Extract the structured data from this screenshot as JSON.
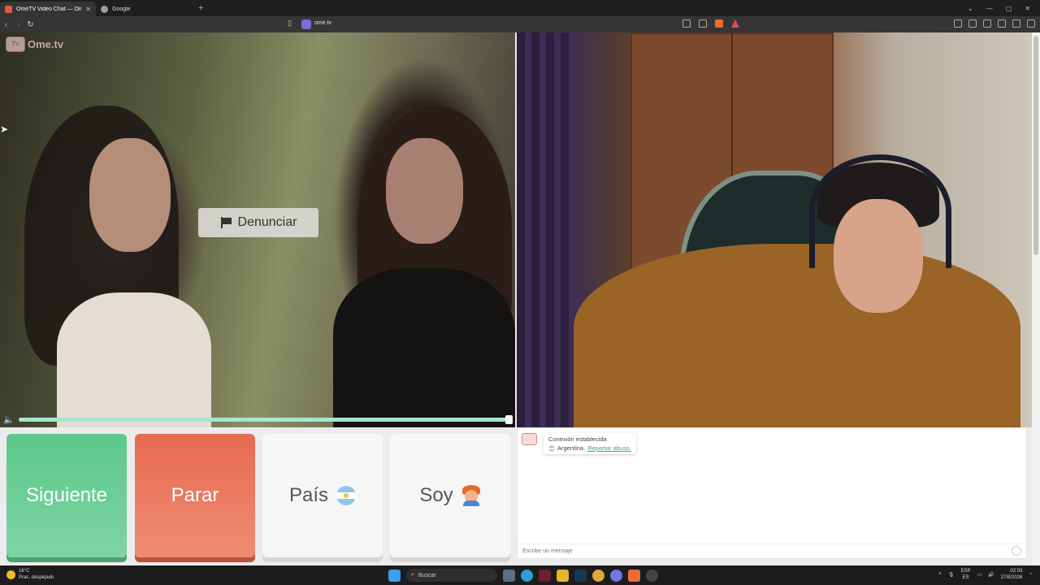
{
  "browser": {
    "tabs": [
      {
        "title": "OmeTV Video Chat — Omeg",
        "active": true,
        "favicon_color": "#e05a45"
      },
      {
        "title": "Google",
        "active": false,
        "favicon_color": "#9aa0a6"
      }
    ],
    "url": "ome.tv"
  },
  "site": {
    "logo_text": "Ome.tv",
    "logo_box_text": "TV"
  },
  "video": {
    "report_label": "Denunciar",
    "volume_level": 1.0
  },
  "controls": {
    "next_label": "Siguiente",
    "stop_label": "Parar",
    "country_label": "País",
    "me_label": "Soy",
    "colors": {
      "next": "#5cc88a",
      "stop": "#e66b51"
    }
  },
  "chat": {
    "status": "Conexión establecida",
    "country": "Argentina.",
    "report_link": "Reportar abuso.",
    "input_placeholder": "Escribe un mensaje"
  },
  "taskbar": {
    "temperature": "16°C",
    "weather": "Prac. despejado",
    "search": "Buscar",
    "lang_top": "ESP",
    "lang_bottom": "ES",
    "time": "02:03",
    "date": "27/8/2026"
  }
}
